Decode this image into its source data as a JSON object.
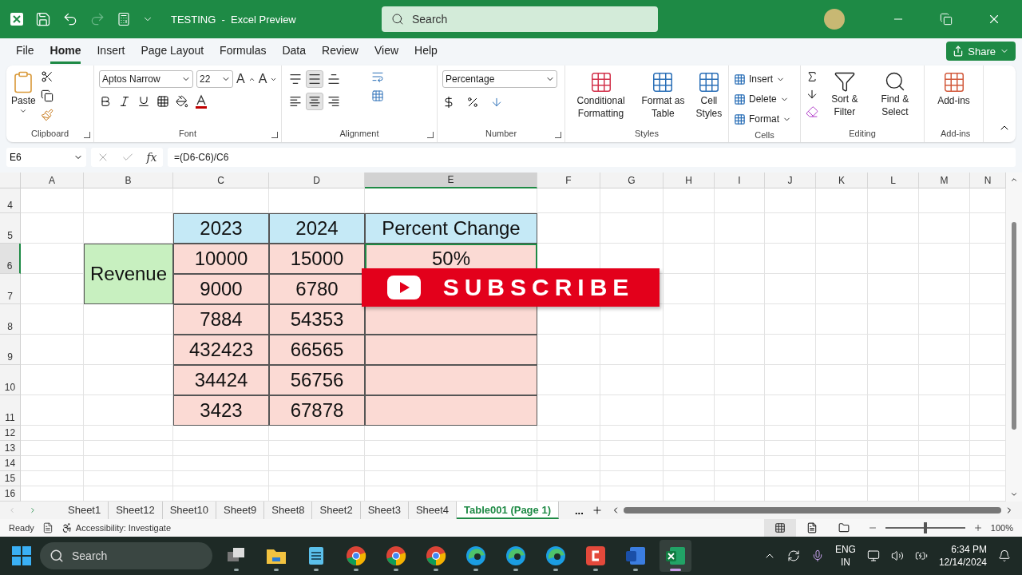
{
  "title_bar": {
    "document_title": "TESTING  -  Excel Preview",
    "search": {
      "placeholder": "Search"
    }
  },
  "menu_tabs": [
    {
      "label": "File",
      "selected": false
    },
    {
      "label": "Home",
      "selected": true
    },
    {
      "label": "Insert",
      "selected": false
    },
    {
      "label": "Page Layout",
      "selected": false
    },
    {
      "label": "Formulas",
      "selected": false
    },
    {
      "label": "Data",
      "selected": false
    },
    {
      "label": "Review",
      "selected": false
    },
    {
      "label": "View",
      "selected": false
    },
    {
      "label": "Help",
      "selected": false
    }
  ],
  "share_button": "Share",
  "ribbon": {
    "paste": "Paste",
    "font_name": "Aptos Narrow",
    "font_size": "22",
    "grow_font": "A",
    "shrink_font": "A",
    "vertical_align": [
      {
        "kind": "top",
        "selected": false
      },
      {
        "kind": "middle",
        "selected": true
      },
      {
        "kind": "bottom",
        "selected": false
      }
    ],
    "horizontal_align": [
      {
        "kind": "left",
        "selected": false
      },
      {
        "kind": "center",
        "selected": true
      },
      {
        "kind": "right",
        "selected": false
      }
    ],
    "number_format": "Percentage",
    "styles": [
      "Conditional Formatting",
      "Format as Table",
      "Cell Styles"
    ],
    "cells": [
      "Insert",
      "Delete",
      "Format"
    ],
    "editing": [
      "Sort & Filter",
      "Find & Select"
    ],
    "add_ins": "Add-ins",
    "groups": [
      "Clipboard",
      "Font",
      "Alignment",
      "Number",
      "Styles",
      "Cells",
      "Editing",
      "Add-ins"
    ]
  },
  "formula_bar": {
    "name_box": "E6",
    "fx": "fx",
    "formula": "=(D6-C6)/C6"
  },
  "columns": [
    {
      "label": "A",
      "selected": false
    },
    {
      "label": "B",
      "selected": false
    },
    {
      "label": "C",
      "selected": false
    },
    {
      "label": "D",
      "selected": false
    },
    {
      "label": "E",
      "selected": true
    },
    {
      "label": "F",
      "selected": false
    },
    {
      "label": "G",
      "selected": false
    },
    {
      "label": "H",
      "selected": false
    },
    {
      "label": "I",
      "selected": false
    },
    {
      "label": "J",
      "selected": false
    },
    {
      "label": "K",
      "selected": false
    },
    {
      "label": "L",
      "selected": false
    },
    {
      "label": "M",
      "selected": false
    },
    {
      "label": "N",
      "selected": false
    }
  ],
  "rows": [
    {
      "label": "4",
      "selected": false
    },
    {
      "label": "5",
      "selected": false
    },
    {
      "label": "6",
      "selected": true
    },
    {
      "label": "7",
      "selected": false
    },
    {
      "label": "8",
      "selected": false
    },
    {
      "label": "9",
      "selected": false
    },
    {
      "label": "10",
      "selected": false
    },
    {
      "label": "11",
      "selected": false
    },
    {
      "label": "12",
      "selected": false
    },
    {
      "label": "13",
      "selected": false
    },
    {
      "label": "14",
      "selected": false
    },
    {
      "label": "15",
      "selected": false
    },
    {
      "label": "16",
      "selected": false
    }
  ],
  "table": {
    "label": "Revenue",
    "header": [
      "2023",
      "2024",
      "Percent Change"
    ],
    "rows": [
      {
        "y2023": "10000",
        "y2024": "15000",
        "change": "50%",
        "active": true
      },
      {
        "y2023": "9000",
        "y2024": "6780"
      },
      {
        "y2023": "7884",
        "y2024": "54353"
      },
      {
        "y2023": "432423",
        "y2024": "66565"
      },
      {
        "y2023": "34424",
        "y2024": "56756"
      },
      {
        "y2023": "3423",
        "y2024": "67878"
      }
    ]
  },
  "overlay": {
    "label": "SUBSCRIBE"
  },
  "sheet_tabs": [
    {
      "label": "Sheet1",
      "selected": false
    },
    {
      "label": "Sheet12",
      "selected": false
    },
    {
      "label": "Sheet10",
      "selected": false
    },
    {
      "label": "Sheet9",
      "selected": false
    },
    {
      "label": "Sheet8",
      "selected": false
    },
    {
      "label": "Sheet2",
      "selected": false
    },
    {
      "label": "Sheet3",
      "selected": false
    },
    {
      "label": "Sheet4",
      "selected": false
    },
    {
      "label": "Table001 (Page 1)",
      "selected": true
    }
  ],
  "more_sheets": "...",
  "status_bar": {
    "state": "Ready",
    "accessibility": "Accessibility: Investigate",
    "views": [
      {
        "kind": "normal",
        "selected": true
      },
      {
        "kind": "page-layout",
        "selected": false
      },
      {
        "kind": "page-break",
        "selected": false
      }
    ],
    "zoom": {
      "level": 0.5
    },
    "zoom_reading": "100%"
  },
  "taskbar": {
    "search": {
      "placeholder": "Search"
    },
    "apps": [
      {
        "kind": "task-view",
        "selected": false
      },
      {
        "kind": "folder",
        "selected": false
      },
      {
        "kind": "notepad",
        "selected": false
      },
      {
        "kind": "chrome",
        "selected": false
      },
      {
        "kind": "chrome",
        "selected": false
      },
      {
        "kind": "chrome",
        "selected": false
      },
      {
        "kind": "edge",
        "selected": false
      },
      {
        "kind": "edge",
        "selected": false
      },
      {
        "kind": "edge",
        "selected": false
      },
      {
        "kind": "video",
        "selected": false
      },
      {
        "kind": "word",
        "selected": false
      },
      {
        "kind": "excel",
        "selected": true
      }
    ],
    "language": [
      "ENG",
      "IN"
    ],
    "time": "6:34 PM",
    "date": "12/14/2024"
  }
}
